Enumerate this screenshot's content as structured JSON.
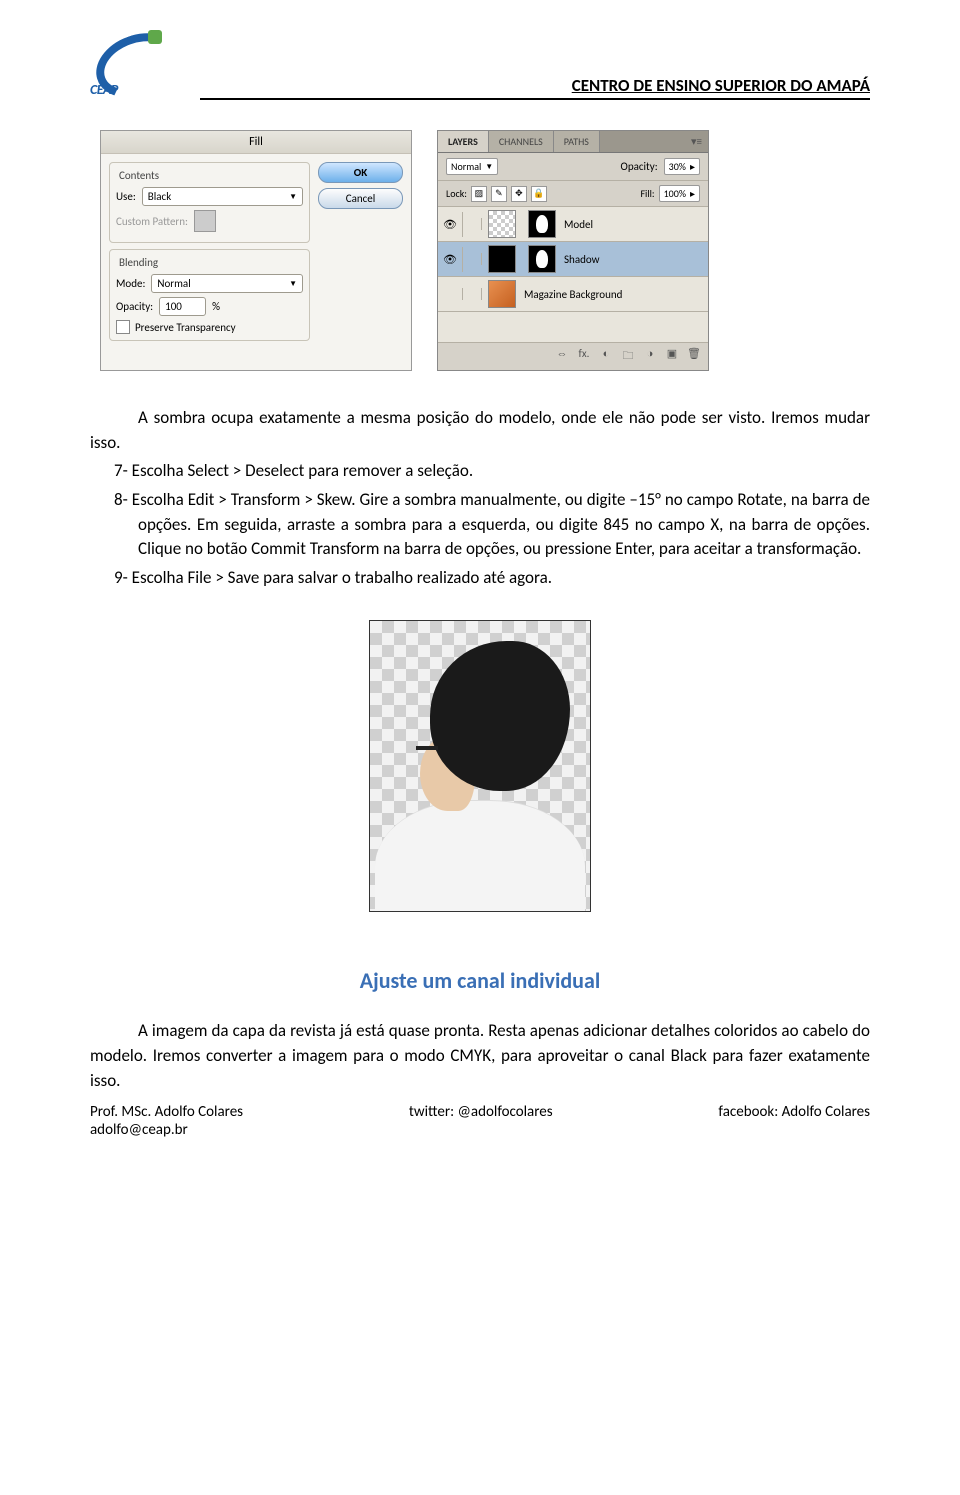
{
  "header": {
    "logo_text": "CEAP",
    "title": "CENTRO DE ENSINO SUPERIOR DO AMAPÁ"
  },
  "fill_dialog": {
    "title": "Fill",
    "contents_label": "Contents",
    "use_label": "Use:",
    "use_value": "Black",
    "custom_pattern_label": "Custom Pattern:",
    "blending_label": "Blending",
    "mode_label": "Mode:",
    "mode_value": "Normal",
    "opacity_label": "Opacity:",
    "opacity_value": "100",
    "opacity_unit": "%",
    "preserve_label": "Preserve Transparency",
    "ok": "OK",
    "cancel": "Cancel"
  },
  "layers_panel": {
    "tab_layers": "LAYERS",
    "tab_channels": "CHANNELS",
    "tab_paths": "PATHS",
    "blend_mode": "Normal",
    "opacity_label": "Opacity:",
    "opacity_value": "30%",
    "lock_label": "Lock:",
    "fill_label": "Fill:",
    "fill_value": "100%",
    "layer1": "Model",
    "layer2": "Shadow",
    "layer3": "Magazine Background",
    "eye": "👁",
    "fx": "fx."
  },
  "body": {
    "p1": "A sombra ocupa exatamente a mesma posição do modelo, onde ele não pode ser visto. Iremos mudar isso.",
    "li7": "7- Escolha Select > Deselect para remover a seleção.",
    "li8": "8- Escolha Edit > Transform > Skew. Gire a sombra manualmente, ou digite –15° no campo Rotate, na barra de opções. Em seguida, arraste a sombra para a esquerda, ou digite 845 no campo X, na barra de opções. Clique no botão Commit Transform na barra de opções, ou pressione Enter, para aceitar a transformação.",
    "li9": "9- Escolha File > Save para salvar o trabalho realizado até agora."
  },
  "section_title": "Ajuste um canal individual",
  "body2": {
    "p1": "A imagem da capa da revista já está quase pronta. Resta apenas adicionar detalhes coloridos ao cabelo do modelo. Iremos converter a imagem para o modo CMYK, para aproveitar o canal Black para fazer exatamente isso."
  },
  "footer": {
    "left1": "Prof. MSc. Adolfo Colares",
    "left2": "adolfo@ceap.br",
    "center": "twitter: @adolfocolares",
    "right": "facebook: Adolfo Colares"
  }
}
